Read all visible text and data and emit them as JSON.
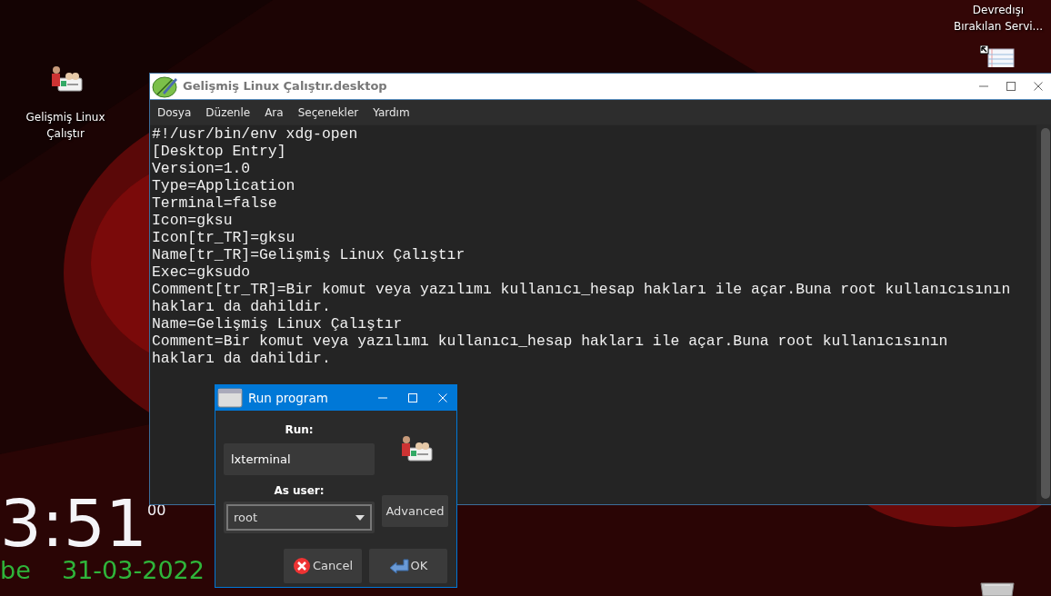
{
  "desktop": {
    "icons": [
      {
        "label": "Gelişmiş Linux Çalıştır",
        "kind": "launcher"
      },
      {
        "label": "Devredışı Bırakılan Servi...",
        "kind": "document"
      },
      {
        "kind": "trash"
      }
    ],
    "clock": {
      "time": "3:51",
      "seconds": "00",
      "day": "be",
      "date": "31-03-2022"
    }
  },
  "editor": {
    "title": "Gelişmiş Linux Çalıştır.desktop",
    "menu": [
      "Dosya",
      "Düzenle",
      "Ara",
      "Seçenekler",
      "Yardım"
    ],
    "lines": [
      "#!/usr/bin/env xdg-open",
      "[Desktop Entry]",
      "Version=1.0",
      "Type=Application",
      "Terminal=false",
      "Icon=gksu",
      "Icon[tr_TR]=gksu",
      "Name[tr_TR]=Gelişmiş Linux Çalıştır",
      "Exec=gksudo",
      "Comment[tr_TR]=Bir komut veya yazılımı kullanıcı_hesap hakları ile açar.Buna root kullanıcısının hakları da dahildir.",
      "Name=Gelişmiş Linux Çalıştır",
      "Comment=Bir komut veya yazılımı kullanıcı_hesap hakları ile açar.Buna root kullanıcısının hakları da dahildir."
    ]
  },
  "dialog": {
    "title": "Run program",
    "run_label": "Run:",
    "run_value": "lxterminal",
    "user_label": "As user:",
    "user_value": "root",
    "advanced": "Advanced",
    "cancel": "Cancel",
    "ok": "OK"
  }
}
